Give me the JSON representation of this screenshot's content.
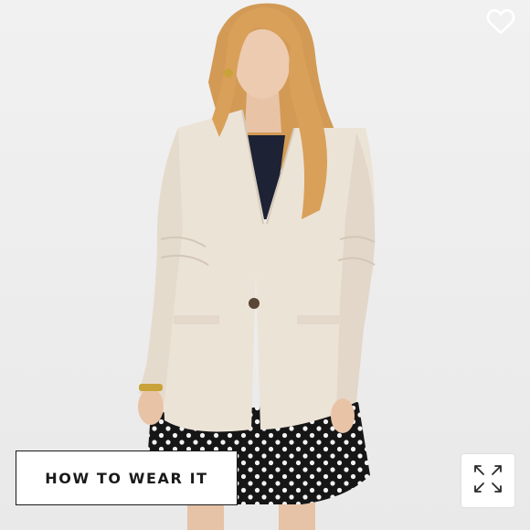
{
  "product_image": {
    "alt_icon": "product-photo",
    "overlay": {
      "how_to_wear_label": "HOW TO WEAR IT",
      "favorite_icon": "heart-outline-icon",
      "expand_icon": "expand-arrows-icon"
    }
  },
  "colors": {
    "background": "#eeeeee",
    "blazer": "#ece3d7",
    "hair": "#d9a05a",
    "skirt": "#1a1a1a",
    "button_border": "#1a1a1a"
  }
}
